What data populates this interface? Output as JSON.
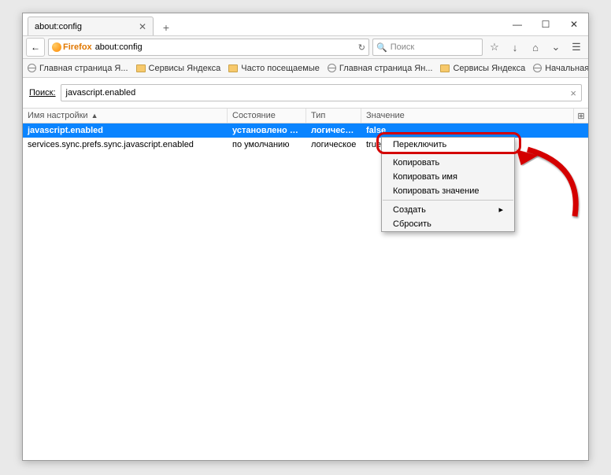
{
  "window": {
    "tab_title": "about:config",
    "minimize": "—",
    "maximize": "☐",
    "close": "✕",
    "newtab": "+",
    "tab_close": "✕"
  },
  "nav": {
    "back": "←",
    "firefox_label": "Firefox",
    "url": "about:config",
    "reload": "↻",
    "search_placeholder": "Поиск",
    "search_icon": "🔍",
    "star": "☆",
    "down": "↓",
    "home": "⌂",
    "pocket": "⌄",
    "menu": "☰"
  },
  "bookmarks": [
    {
      "icon": "globe",
      "label": "Главная страница Я..."
    },
    {
      "icon": "folder",
      "label": "Сервисы Яндекса"
    },
    {
      "icon": "folder",
      "label": "Часто посещаемые"
    },
    {
      "icon": "globe",
      "label": "Главная страница Ян..."
    },
    {
      "icon": "folder",
      "label": "Сервисы Яндекса"
    },
    {
      "icon": "globe",
      "label": "Начальная страница"
    }
  ],
  "filter": {
    "label": "Поиск:",
    "value": "javascript.enabled",
    "clear": "×"
  },
  "columns": {
    "name": "Имя настройки",
    "status": "Состояние",
    "type": "Тип",
    "value": "Значение",
    "sort": "▲",
    "config": "⊞"
  },
  "rows": [
    {
      "name": "javascript.enabled",
      "status": "установлено по...",
      "type": "логическ...",
      "value": "false",
      "selected": true
    },
    {
      "name": "services.sync.prefs.sync.javascript.enabled",
      "status": "по умолчанию",
      "type": "логическое",
      "value": "true",
      "selected": false
    }
  ],
  "context": {
    "toggle": "Переключить",
    "copy": "Копировать",
    "copy_name": "Копировать имя",
    "copy_value": "Копировать значение",
    "create": "Создать",
    "create_arrow": "▸",
    "reset": "Сбросить"
  }
}
